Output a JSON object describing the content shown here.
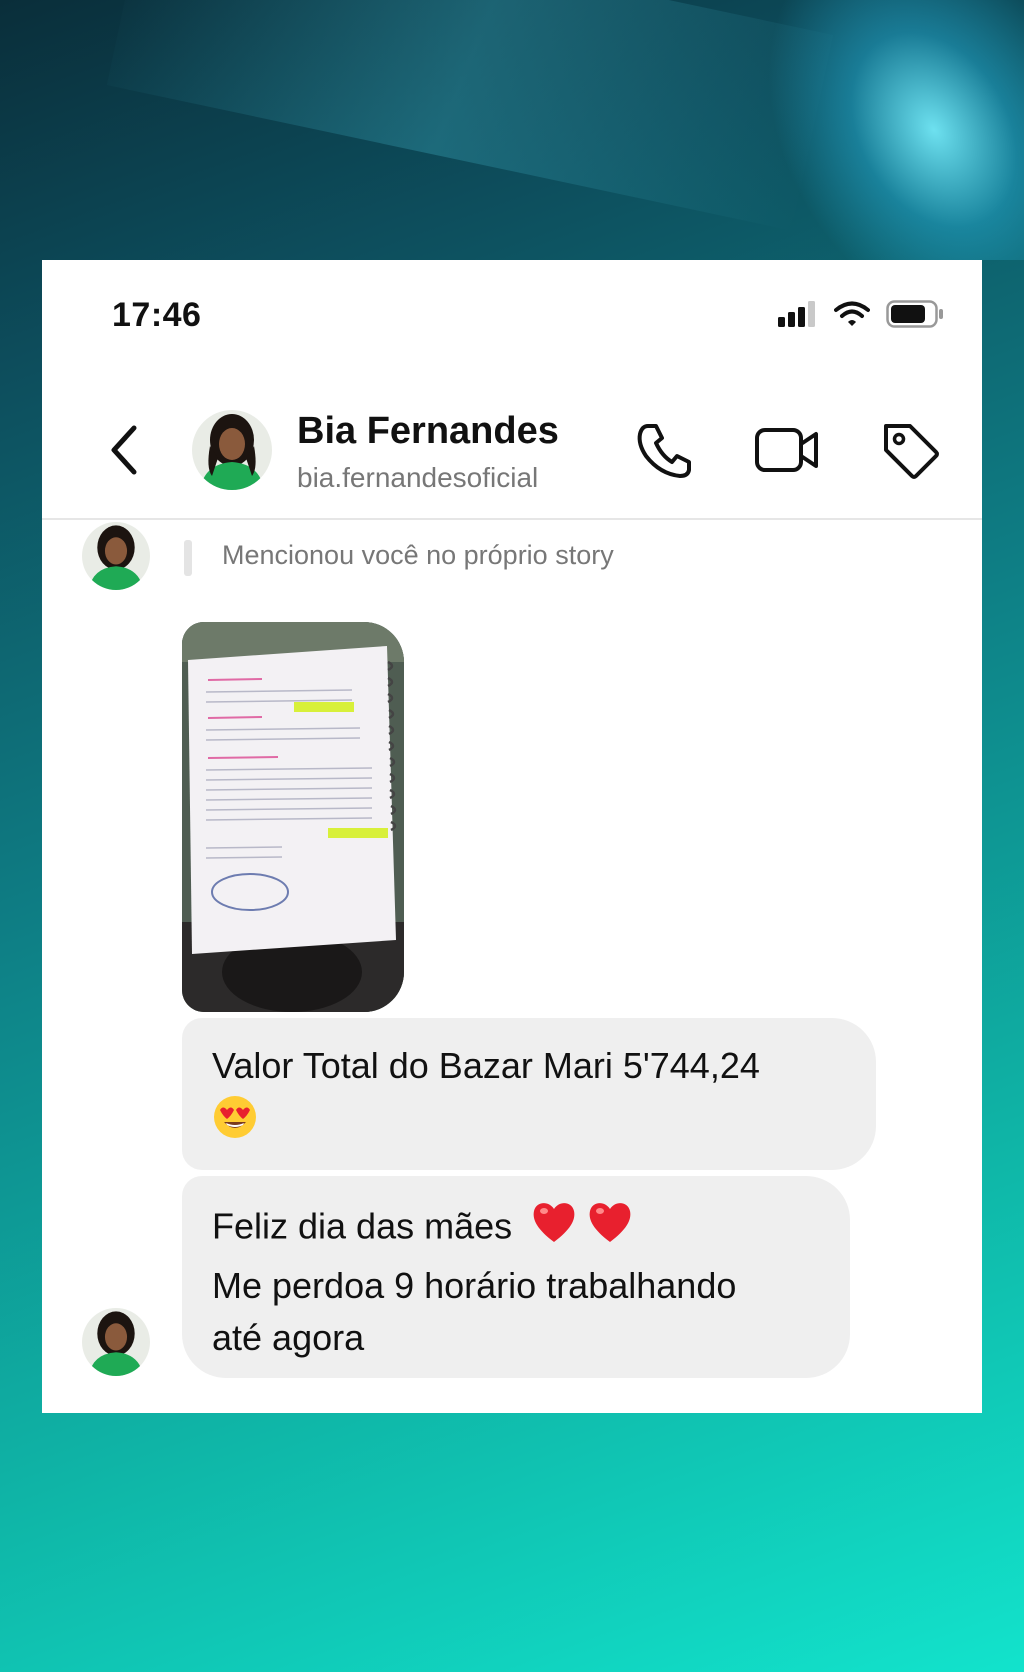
{
  "status": {
    "time": "17:46"
  },
  "header": {
    "name": "Bia Fernandes",
    "handle": "bia.fernandesoficial"
  },
  "mention": {
    "text": "Mencionou você no próprio story"
  },
  "messages": [
    {
      "line1": "Valor Total do Bazar Mari 5'744,24",
      "emoji": "heart-eyes"
    },
    {
      "line1": "Feliz dia das mães",
      "line2": "Me perdoa 9 horário trabalhando",
      "line3": "até agora",
      "emoji": "red-hearts"
    }
  ],
  "colors": {
    "bubble": "#efefef",
    "avatar_shirt": "#1faa55",
    "highlight": "#d8f03a"
  },
  "icons": [
    "back-chevron-icon",
    "phone-icon",
    "video-camera-icon",
    "tag-icon",
    "signal-icon",
    "wifi-icon",
    "battery-icon"
  ]
}
